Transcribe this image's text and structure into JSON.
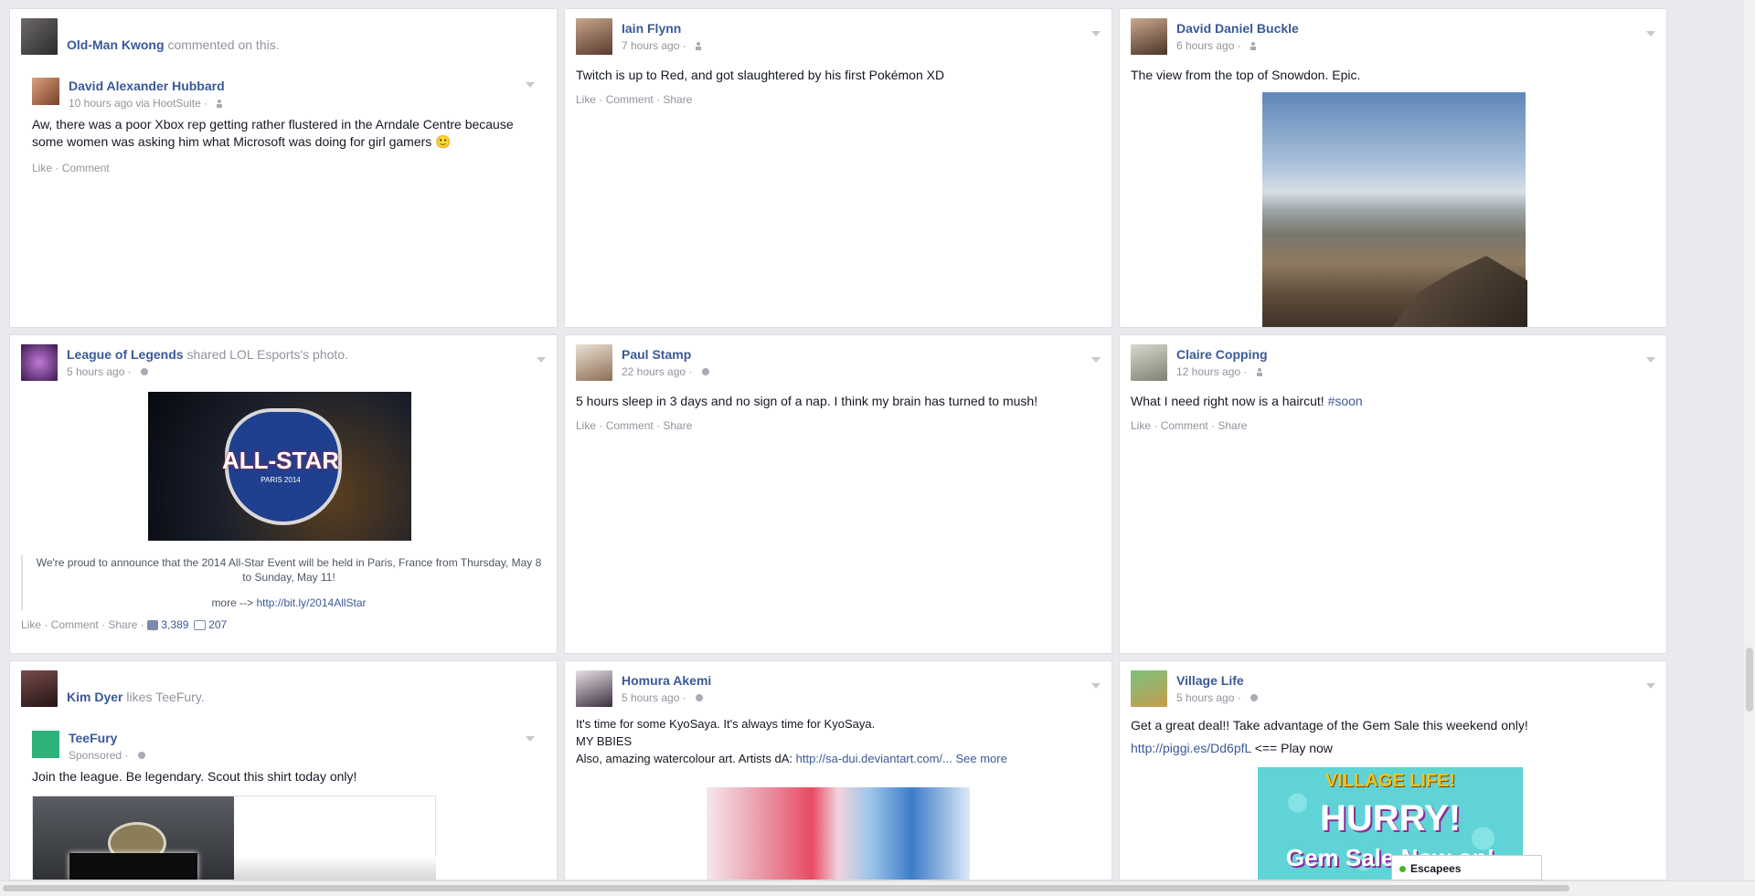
{
  "posts": {
    "p1": {
      "actor": "Old-Man Kwong",
      "action": "commented on this.",
      "inner_author": "David Alexander Hubbard",
      "inner_time": "10 hours ago via HootSuite ·",
      "text": "Aw, there was a poor Xbox rep getting rather flustered in the Arndale Centre because some women was asking him what Microsoft was doing for girl gamers 🙂",
      "like": "Like",
      "comment": "Comment"
    },
    "p2": {
      "author": "Iain Flynn",
      "time": "7 hours ago ·",
      "text": "Twitch is up to Red, and got slaughtered by his first Pokémon XD",
      "like": "Like",
      "comment": "Comment",
      "share": "Share"
    },
    "p3": {
      "author": "David Daniel Buckle",
      "time": "6 hours ago ·",
      "text": "The view from the top of Snowdon. Epic."
    },
    "p4": {
      "author": "League of Legends",
      "action": "shared",
      "shared_from": "LOL Esports",
      "action_tail": "'s photo.",
      "time": "5 hours ago ·",
      "banner_title": "ALL-STAR",
      "banner_sub": "PARIS 2014",
      "quote": "We're proud to announce that the 2014 All-Star Event will be held in Paris, France from Thursday, May 8 to Sunday, May 11!",
      "more_prefix": "more -->",
      "more_link": "http://bit.ly/2014AllStar",
      "like": "Like",
      "comment": "Comment",
      "share": "Share",
      "likes_count": "3,389",
      "comments_count": "207"
    },
    "p5": {
      "author": "Paul Stamp",
      "time": "22 hours ago ·",
      "text": "5 hours sleep in 3 days and no sign of a nap. I think my brain has turned to mush!",
      "like": "Like",
      "comment": "Comment",
      "share": "Share"
    },
    "p6": {
      "author": "Claire Copping",
      "time": "12 hours ago ·",
      "text": "What I need right now is a haircut!",
      "hashtag": "#soon",
      "like": "Like",
      "comment": "Comment",
      "share": "Share"
    },
    "p7": {
      "actor": "Kim Dyer",
      "action": "likes",
      "liked": "TeeFury.",
      "inner_author": "TeeFury",
      "inner_time": "Sponsored ·",
      "text": "Join the league. Be legendary. Scout this shirt today only!"
    },
    "p8": {
      "author": "Homura Akemi",
      "time": "5 hours ago ·",
      "line1": "It's time for some KyoSaya. It's always time for KyoSaya.",
      "line2": "MY BBIES",
      "line3": "Also, amazing watercolour art. Artists dA:",
      "link": "http://sa-dui.deviantart.com/...",
      "see_more": "See more"
    },
    "p9": {
      "author": "Village Life",
      "time": "5 hours ago ·",
      "text": "Get a great deal!! Take advantage of the Gem Sale this weekend only!",
      "link": "http://piggi.es/Dd6pfL",
      "link_tail": "<== Play now",
      "banner_top": "VILLAGE LIFE!",
      "banner_hurry": "HURRY!",
      "banner_sale": "Gem Sale Now on!"
    }
  },
  "chat": {
    "label": "Escapees"
  }
}
